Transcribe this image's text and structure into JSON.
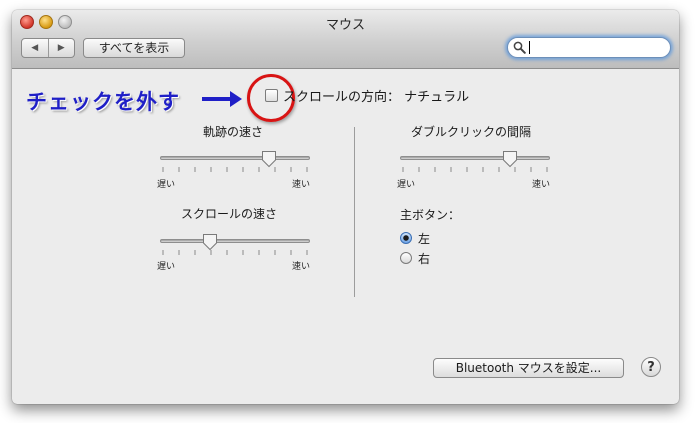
{
  "window": {
    "title": "マウス"
  },
  "toolbar": {
    "back_icon": "◀",
    "forward_icon": "▶",
    "show_all_label": "すべてを表示",
    "search_placeholder": "",
    "search_value": ""
  },
  "annotation": {
    "text": "チェックを外す",
    "color": "#1f1fc7"
  },
  "scroll_direction": {
    "label": "スクロールの方向： ナチュラル",
    "checked": false
  },
  "tracking": {
    "label": "軌跡の速さ",
    "slow": "遅い",
    "fast": "速い",
    "value": 0.75
  },
  "double_click": {
    "label": "ダブルクリックの間隔",
    "slow": "遅い",
    "fast": "速い",
    "value": 0.76
  },
  "scrolling": {
    "label": "スクロールの速さ",
    "slow": "遅い",
    "fast": "速い",
    "value": 0.31
  },
  "primary_button": {
    "label": "主ボタン：",
    "options": [
      {
        "label": "左",
        "selected": true
      },
      {
        "label": "右",
        "selected": false
      }
    ]
  },
  "bluetooth_button": {
    "label": "Bluetooth マウスを設定..."
  },
  "help_button": {
    "label": "?"
  },
  "colors": {
    "highlight_circle": "#d81414",
    "annotation_text": "#1f1fc7",
    "search_focus": "#5a96dc"
  }
}
